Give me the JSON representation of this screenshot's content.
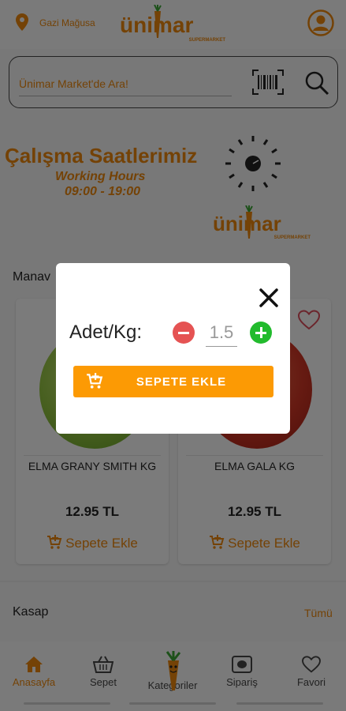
{
  "header": {
    "location_text": "Gazi Mağusa",
    "logo_text": "ünimar",
    "logo_sub": "SUPERMARKET"
  },
  "search": {
    "placeholder": "Ünimar Market'de Ara!"
  },
  "banner": {
    "title": "Çalışma Saatlerimiz",
    "subtitle": "Working Hours",
    "hours": "09:00 - 19:00",
    "logo_text": "ünimar",
    "logo_sub": "SUPERMARKET"
  },
  "section": {
    "title": "Manav",
    "products": [
      {
        "name": "ELMA GRANY SMITH KG",
        "price": "12.95 TL",
        "cart_label": "Sepete Ekle"
      },
      {
        "name": "ELMA GALA KG",
        "price": "12.95 TL",
        "cart_label": "Sepete Ekle"
      }
    ]
  },
  "next_section": {
    "title": "Kasap",
    "see_all": "Tümü"
  },
  "bottom_nav": [
    {
      "label": "Anasayfa",
      "icon": "home-icon",
      "active": true
    },
    {
      "label": "Sepet",
      "icon": "basket-icon",
      "active": false
    },
    {
      "label": "Kategoriler",
      "icon": "carrot-icon",
      "active": false
    },
    {
      "label": "Sipariş",
      "icon": "order-icon",
      "active": false
    },
    {
      "label": "Favori",
      "icon": "heart-icon",
      "active": false
    }
  ],
  "modal": {
    "qty_label": "Adet/Kg:",
    "qty_value": "1.5",
    "add_label": "SEPETE EKLE"
  },
  "colors": {
    "accent": "#e8850c",
    "button": "#fc9a04",
    "minus": "#e55353",
    "plus": "#22bb2d"
  }
}
